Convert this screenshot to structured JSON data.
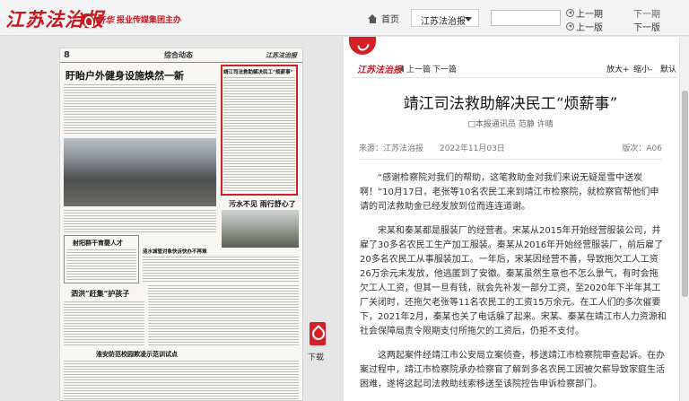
{
  "header": {
    "logo": "江苏法治报",
    "group_brand": "新华",
    "group_tagline": "报业传媒集团主办",
    "home_label": "首页",
    "paper_select": "江苏法治报",
    "search_placeholder": "",
    "prev_issue": "上一期",
    "next_issue": "下一期",
    "prev_page": "上一版",
    "next_page": "下一版"
  },
  "newspaper": {
    "page_no": "8",
    "section": "综合动态",
    "masthead": "江苏法治报",
    "headlines": {
      "top_left": "盱眙户外健身设施焕然一新",
      "top_right": "靖江司法救助解决民工“烦薪事”",
      "mid_right": "污水不见 雨行舒心了",
      "mid_left": "射阳群干育婴人才",
      "mid_center": "涟水城管对象快诉快办不再难",
      "lower_left": "泗洪“赶集”护孩子",
      "bottom_left": "淮安防范校园欺凌示范训试点"
    },
    "download_label": "下载"
  },
  "article": {
    "logo": "江苏法治报",
    "prev_label": "上一篇",
    "next_label": "下一篇",
    "zoom_in": "放大+",
    "zoom_out": "缩小-",
    "reset": "默认",
    "title": "靖江司法救助解决民工“烦薪事”",
    "byline": "□本报通讯员 范静 许晴",
    "source": "来源：江苏法治报",
    "date": "2022年11月03日",
    "edition": "版次：A06",
    "paragraphs": [
      "“感谢检察院对我们的帮助，这笔救助金对我们来说无疑是雪中送炭啊！”10月17日，老张等10名农民工来到靖江市检察院，就检察官帮他们申请的司法救助金已经发放到位而连连道谢。",
      "宋某和秦某都是服装厂的经营者。宋某从2015年开始经营服装公司，并雇了30多名农民工生产加工服装。秦某从2016年开始经营服装厂，前后雇了20多名农民工从事服装加工。一年后，宋某因经营不善，导致拖欠工人工资26万余元未发放，他逃匿到了安徽。秦某虽然生意也不怎么景气，有时会拖欠工人工资，但其一旦有钱，就会先补发一部分工资，至2020年下半年其工厂关闭时，还拖欠老张等11名农民工的工资15万余元。在工人们的多次催要下，2021年2月，秦某也关了电话躲了起来。宋某、秦某在靖江市人力资源和社会保障局责令限期支付所拖欠的工资后，仍拒不支付。",
      "这两起案件经靖江市公安局立案侦查，移送靖江市检察院审查起诉。在办案过程中，靖江市检察院承办检察官了解到多名农民工因被欠薪导致家庭生活困难，遂将这起司法救助线索移送至该院控告申诉检察部门。"
    ]
  },
  "colors": {
    "brand_red": "#c8171e",
    "highlight_red": "#d41f26"
  }
}
